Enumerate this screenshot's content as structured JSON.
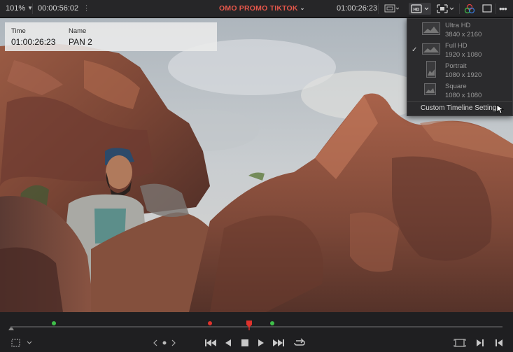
{
  "toolbar": {
    "zoom_value": "101%",
    "source_timecode": "00:00:56:02",
    "timeline_name": "OMO PROMO TIKTOK",
    "record_timecode": "01:00:26:23"
  },
  "overlay": {
    "time_label": "Time",
    "time_value": "01:00:26:23",
    "name_label": "Name",
    "name_value": "PAN 2"
  },
  "resolution_menu": {
    "items": [
      {
        "name": "Ultra HD",
        "resolution": "3840 x 2160",
        "selected": false
      },
      {
        "name": "Full HD",
        "resolution": "1920 x 1080",
        "selected": true
      },
      {
        "name": "Portrait",
        "resolution": "1080 x 1920",
        "selected": false
      },
      {
        "name": "Square",
        "resolution": "1080 x 1080",
        "selected": false
      }
    ],
    "check_glyph": "✓",
    "custom_label": "Custom Timeline Settings"
  },
  "scrubber": {
    "marker_colors": {
      "green": "#3fbf4a",
      "red": "#e0322c"
    }
  },
  "colors": {
    "accent": "#e5574b"
  }
}
